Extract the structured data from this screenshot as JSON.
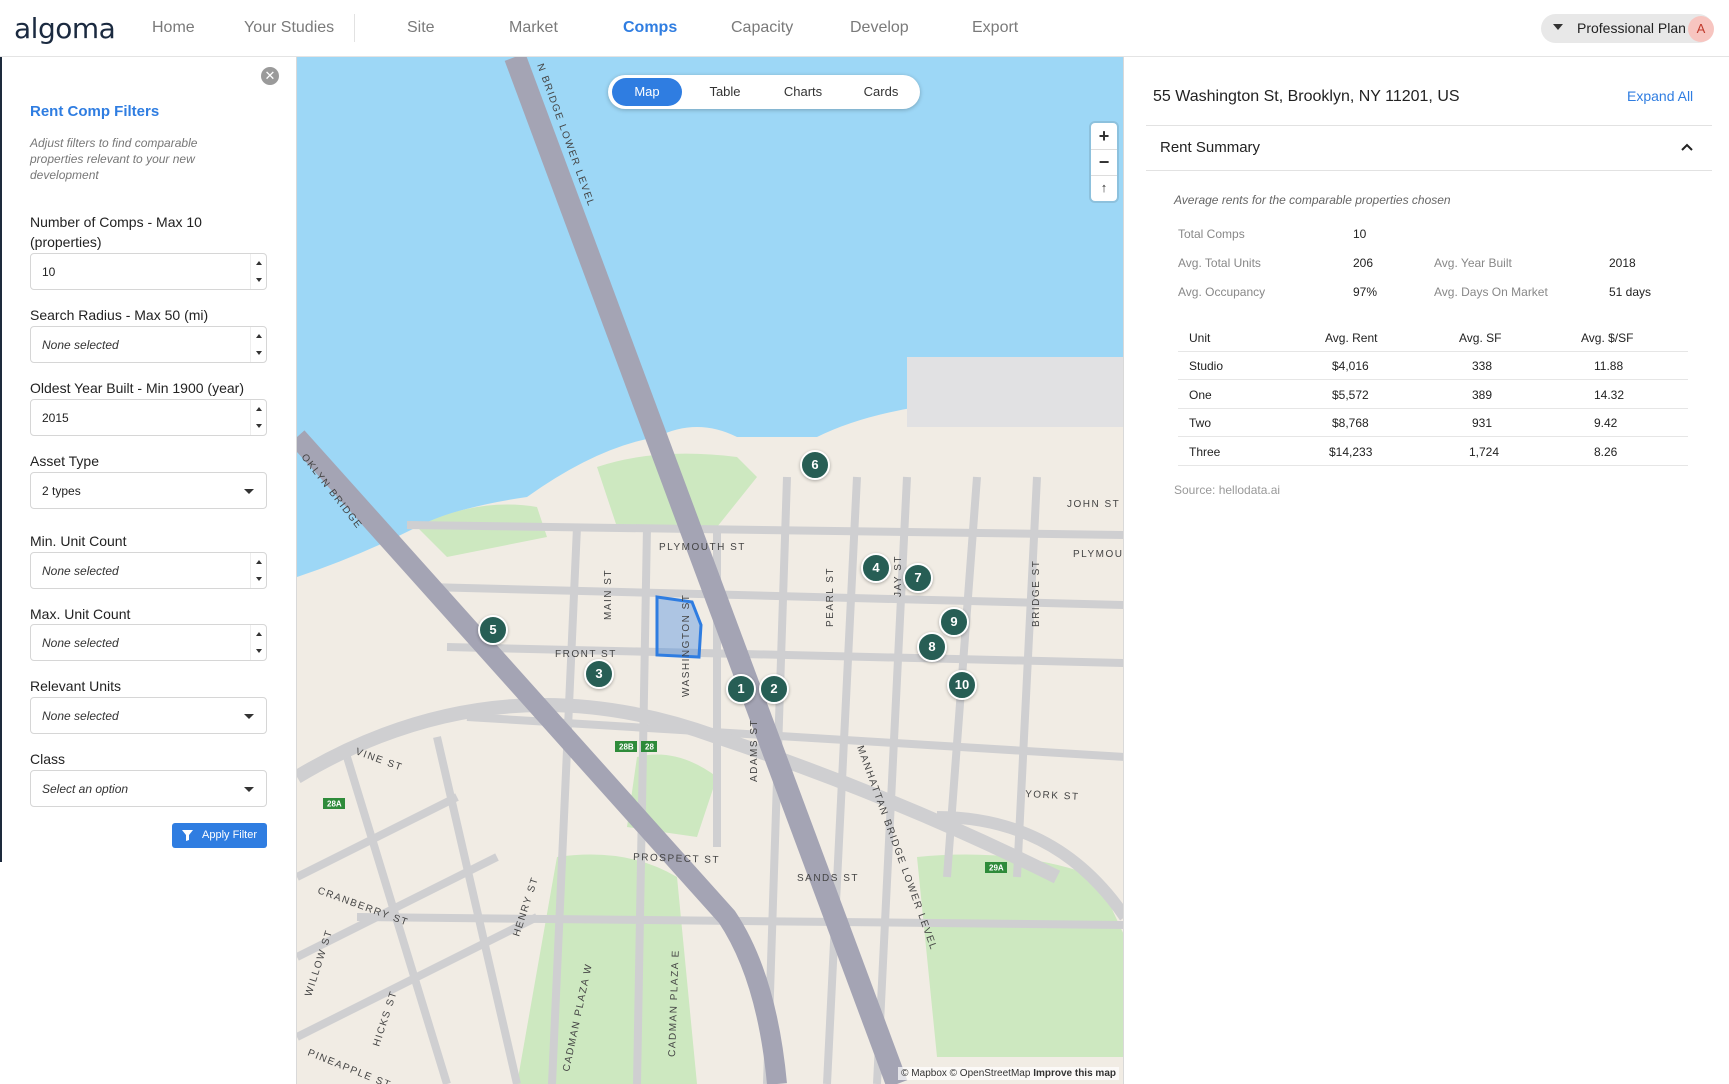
{
  "app": {
    "logo": "algoma"
  },
  "nav": {
    "items": [
      {
        "label": "Home",
        "active": false
      },
      {
        "label": "Your Studies",
        "active": false
      },
      {
        "label": "Site",
        "active": false
      },
      {
        "label": "Market",
        "active": false
      },
      {
        "label": "Comps",
        "active": true
      },
      {
        "label": "Capacity",
        "active": false
      },
      {
        "label": "Develop",
        "active": false
      },
      {
        "label": "Export",
        "active": false
      }
    ],
    "plan": "Professional Plan",
    "avatar_initial": "A"
  },
  "filters": {
    "title": "Rent Comp Filters",
    "description": "Adjust filters to find comparable properties relevant to your new development",
    "fields": [
      {
        "label": "Number of Comps - Max 10 (properties)",
        "value": "10",
        "type": "number"
      },
      {
        "label": "Search Radius - Max 50 (mi)",
        "value": "None selected",
        "type": "number"
      },
      {
        "label": "Oldest Year Built - Min 1900 (year)",
        "value": "2015",
        "type": "number"
      },
      {
        "label": "Asset Type",
        "value": "2 types",
        "type": "select"
      },
      {
        "label": "Min. Unit Count",
        "value": "None selected",
        "type": "number"
      },
      {
        "label": "Max. Unit Count",
        "value": "None selected",
        "type": "number"
      },
      {
        "label": "Relevant Units",
        "value": "None selected",
        "type": "select"
      },
      {
        "label": "Class",
        "value": "Select an option",
        "type": "select"
      }
    ],
    "apply_label": "Apply Filter"
  },
  "map": {
    "view_tabs": [
      {
        "label": "Map",
        "active": true
      },
      {
        "label": "Table",
        "active": false
      },
      {
        "label": "Charts",
        "active": false
      },
      {
        "label": "Cards",
        "active": false
      }
    ],
    "zoom_in": "+",
    "zoom_out": "−",
    "compass": "↑",
    "street_labels": [
      "PLYMOUTH ST",
      "FRONT ST",
      "YORK ST",
      "PROSPECT ST",
      "SANDS ST",
      "JOHN ST",
      "WASHINGTON ST",
      "MAIN ST",
      "PEARL ST",
      "JAY ST",
      "ADAMS ST",
      "BRIDGE ST",
      "VINE ST",
      "CRANBERRY ST",
      "HENRY ST",
      "HICKS ST",
      "WILLOW ST",
      "PINEAPPLE ST",
      "CADMAN PLAZA W",
      "CADMAN PLAZA E",
      "MANHATTAN BRIDGE LOWER LEVEL",
      "OKLYN BRIDGE",
      "N BRIDGE LOWER LEVEL",
      "PLYMOU"
    ],
    "exit_labels": [
      "28B",
      "28",
      "28A",
      "29A"
    ],
    "comps": [
      "1",
      "2",
      "3",
      "4",
      "5",
      "6",
      "7",
      "8",
      "9",
      "10"
    ],
    "attribution": "© Mapbox © OpenStreetMap",
    "improve": "Improve this map",
    "colors": {
      "water": "#9dd7f6",
      "land": "#f1ece4",
      "park": "#cde8c0",
      "road": "#cfcfd1",
      "bridge": "#a4a4b4",
      "pin": "#275e55",
      "site": "#2f7de1"
    }
  },
  "summary": {
    "address": "55 Washington St, Brooklyn, NY 11201, US",
    "expand_all": "Expand All",
    "section_title": "Rent Summary",
    "description": "Average rents for the comparable properties chosen",
    "stats": {
      "total_comps_label": "Total Comps",
      "total_comps": "10",
      "avg_total_units_label": "Avg. Total Units",
      "avg_total_units": "206",
      "avg_year_built_label": "Avg. Year Built",
      "avg_year_built": "2018",
      "avg_occupancy_label": "Avg. Occupancy",
      "avg_occupancy": "97%",
      "avg_days_label": "Avg. Days On Market",
      "avg_days": "51 days"
    },
    "table": {
      "headers": [
        "Unit",
        "Avg. Rent",
        "Avg. SF",
        "Avg. $/SF"
      ],
      "rows": [
        [
          "Studio",
          "$4,016",
          "338",
          "11.88"
        ],
        [
          "One",
          "$5,572",
          "389",
          "14.32"
        ],
        [
          "Two",
          "$8,768",
          "931",
          "9.42"
        ],
        [
          "Three",
          "$14,233",
          "1,724",
          "8.26"
        ]
      ]
    },
    "source": "Source: hellodata.ai"
  }
}
